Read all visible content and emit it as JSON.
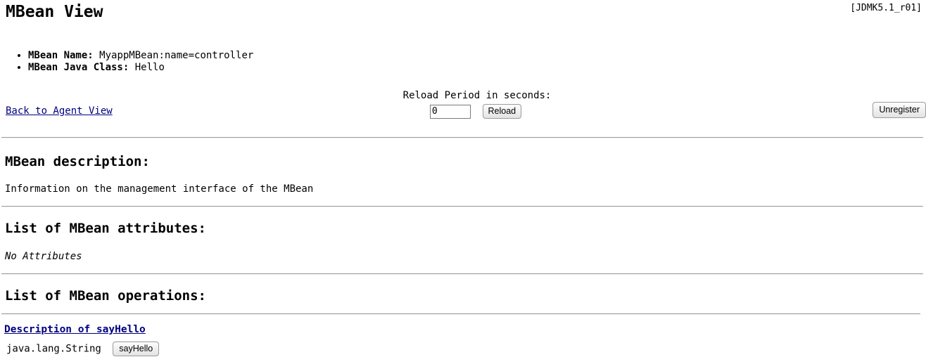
{
  "header": {
    "title": "MBean View",
    "version": "[JDMK5.1_r01]"
  },
  "info": {
    "items": [
      {
        "label": "MBean Name:",
        "value": "MyappMBean:name=controller"
      },
      {
        "label": "MBean Java Class:",
        "value": "Hello"
      }
    ]
  },
  "controls": {
    "back_link": "Back to Agent View",
    "reload_label": "Reload Period in seconds:",
    "reload_value": "0",
    "reload_placeholder": "",
    "reload_button": "Reload",
    "unregister_button": "Unregister"
  },
  "description_section": {
    "heading": "MBean description:",
    "text": "Information on the management interface of the MBean"
  },
  "attributes_section": {
    "heading": "List of MBean attributes:",
    "empty_text": "No Attributes"
  },
  "operations_section": {
    "heading": "List of MBean operations:",
    "operations": [
      {
        "description_link": "Description of sayHello",
        "return_type": "java.lang.String",
        "invoke_button": "sayHello"
      }
    ]
  },
  "colors": {
    "link": "#000080",
    "rule": "#9c9c9c",
    "text": "#000000",
    "background": "#ffffff"
  }
}
